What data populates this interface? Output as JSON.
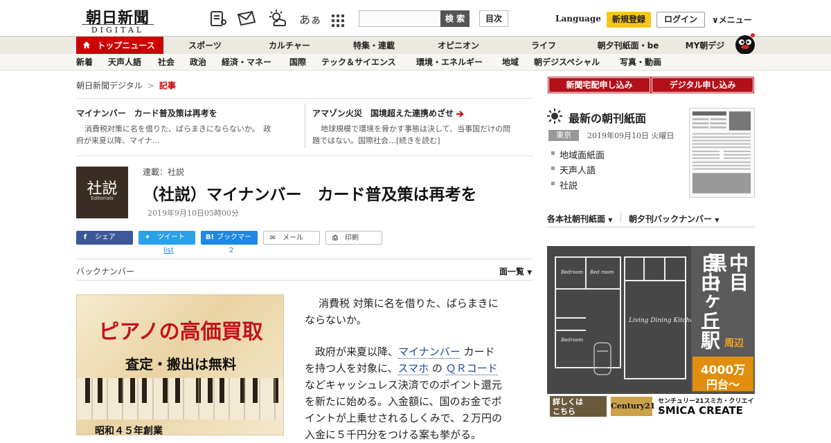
{
  "header": {
    "logo_main": "朝日新聞",
    "logo_sub": "DIGITAL",
    "font_toggle": "あぁ",
    "search_placeholder": "",
    "search_button": "検 索",
    "toc_button": "目次",
    "language": "Language",
    "register": "新規登録",
    "login": "ログイン",
    "menu": "∨メニュー"
  },
  "global_nav": [
    "トップニュース",
    "スポーツ",
    "カルチャー",
    "特集・連載",
    "オピニオン",
    "ライフ",
    "朝夕刊紙面・be",
    "MY朝デジ"
  ],
  "sub_nav": [
    "新着",
    "天声人語",
    "社会",
    "政治",
    "経済・マネー",
    "国際",
    "テック＆サイエンス",
    "環境・エネルギー",
    "地域",
    "朝デジスペシャル",
    "写真・動画"
  ],
  "breadcrumb": {
    "home": "朝日新聞デジタル",
    "sep": ">",
    "current": "記事"
  },
  "related": [
    {
      "title": "マイナンバー　カード普及策は再考を",
      "body_l1": "消費税対策に名を借りた、ばらまきにならないか。　政",
      "body_l2": "府が来夏以降、マイナ…"
    },
    {
      "title": "アマゾン火災　国境超えた連携めざせ",
      "body_l1": "地球規模で環境を脅かす事態は決して、当事国だけの問",
      "body_l2": "題ではない。国際社会…[続きを読む]"
    }
  ],
  "article": {
    "thumb_big": "社説",
    "thumb_small": "Editorials",
    "series": "連載：社説",
    "title": "（社説）マイナンバー　カード普及策は再考を",
    "date": "2019年9月10日05時00分",
    "body": [
      [
        "消費税 対策に名を借りた、ばらまきに",
        "ならないか。"
      ],
      [
        "政府が来夏以降、",
        "マイナンバー",
        " カード",
        "を持つ人を対象に、",
        "スマホ",
        " の ",
        "ＱＲコード",
        "などキャッシュレス決済でのポイント還元",
        "を新たに始める。入金額に、国のお金でポ",
        "イントが上乗せされるしくみで、２万円の",
        "入金に５千円分をつける案も挙がる。"
      ]
    ]
  },
  "share": {
    "facebook": "シェア",
    "twitter": "ツイート",
    "twitter_sub": "list",
    "hatena": "ブックマーク",
    "hatena_count": "2",
    "mail": "メール",
    "print": "印刷"
  },
  "backnumber": {
    "label": "バックナンバー",
    "list": "面一覧"
  },
  "ad_piano": {
    "t1": "ピアノの高価買取",
    "t2": "査定・搬出は無料",
    "t3": "昭和４５年創業"
  },
  "sidebar": {
    "btn_home": "新聞宅配申し込み",
    "btn_digital": "デジタル申し込み",
    "np_title": "最新の朝刊紙面",
    "np_city": "東京",
    "np_date": "2019年09月10日 火曜日",
    "np_links": [
      "地域面紙面",
      "天声人語",
      "社説"
    ],
    "dd1": "各本社朝刊紙面",
    "dd2": "朝夕刊バックナンバー"
  },
  "ad_house": {
    "v1": "中目黒・",
    "v2": "自由ヶ丘駅",
    "sub": "周辺",
    "price1": "4000万",
    "price2": "円台〜",
    "more": "詳しくは\nこちら",
    "brand_jp": "センチュリー21スミカ・クリエイト",
    "brand_en": "SMICA CREATE",
    "room_bed1": "Bedroom",
    "room_bed2": "Bed room",
    "room_bed3": "Bedroom",
    "room_ldk": "Living Dining Kitchen"
  }
}
